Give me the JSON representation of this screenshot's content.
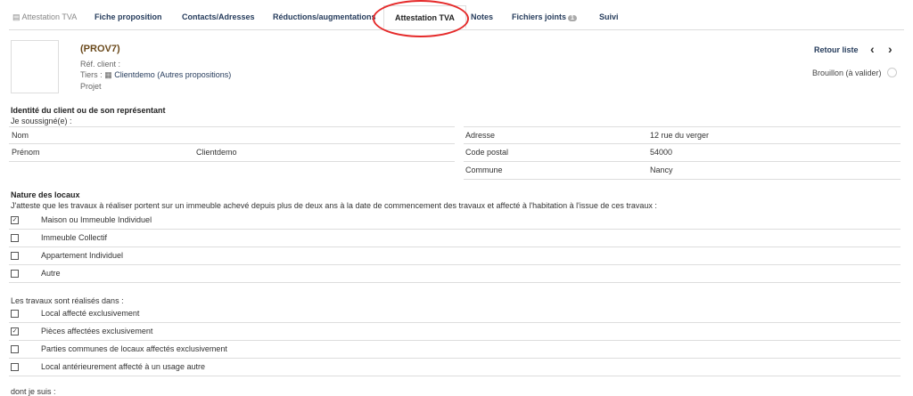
{
  "tabs": [
    {
      "label": "Attestation TVA"
    },
    {
      "label": "Fiche proposition"
    },
    {
      "label": "Contacts/Adresses"
    },
    {
      "label": "Réductions/augmentations"
    },
    {
      "label": "Attestation TVA"
    },
    {
      "label": "Notes"
    },
    {
      "label": "Fichiers joints",
      "badge": "1"
    },
    {
      "label": "Suivi"
    }
  ],
  "header": {
    "ref": "(PROV7)",
    "ref_client": "Réf. client :",
    "tiers_label": "Tiers :",
    "tiers": "Clientdemo",
    "other": "(Autres propositions)",
    "projet": "Projet",
    "back": "Retour liste",
    "prev": "‹",
    "next": "›",
    "status": "Brouillon (à valider)"
  },
  "identity": {
    "title": "Identité du client ou de son représentant",
    "intro": "Je soussigné(e) :",
    "left": [
      {
        "label": "Nom",
        "value": ""
      },
      {
        "label": "Prénom",
        "value": "Clientdemo"
      }
    ],
    "right": [
      {
        "label": "Adresse",
        "value": "12 rue du verger"
      },
      {
        "label": "Code postal",
        "value": "54000"
      },
      {
        "label": "Commune",
        "value": "Nancy"
      }
    ]
  },
  "nature": {
    "title": "Nature des locaux",
    "intro": "J'atteste que les travaux à réaliser portent sur un immeuble achevé depuis plus de deux ans à la date de commencement des travaux et affecté à l'habitation à l'issue de ces travaux :",
    "options": [
      {
        "label": "Maison ou Immeuble Individuel",
        "checked": true
      },
      {
        "label": "Immeuble Collectif",
        "checked": false
      },
      {
        "label": "Appartement Individuel",
        "checked": false
      },
      {
        "label": "Autre",
        "checked": false
      }
    ]
  },
  "travaux": {
    "intro": "Les travaux sont réalisés dans :",
    "options": [
      {
        "label": "Local affecté exclusivement",
        "checked": false
      },
      {
        "label": "Pièces affectées exclusivement",
        "checked": true
      },
      {
        "label": "Parties communes de locaux affectés exclusivement",
        "checked": false
      },
      {
        "label": "Local antérieurement affecté à un usage autre",
        "checked": false
      }
    ]
  },
  "footer": {
    "text": "dont je suis :"
  }
}
